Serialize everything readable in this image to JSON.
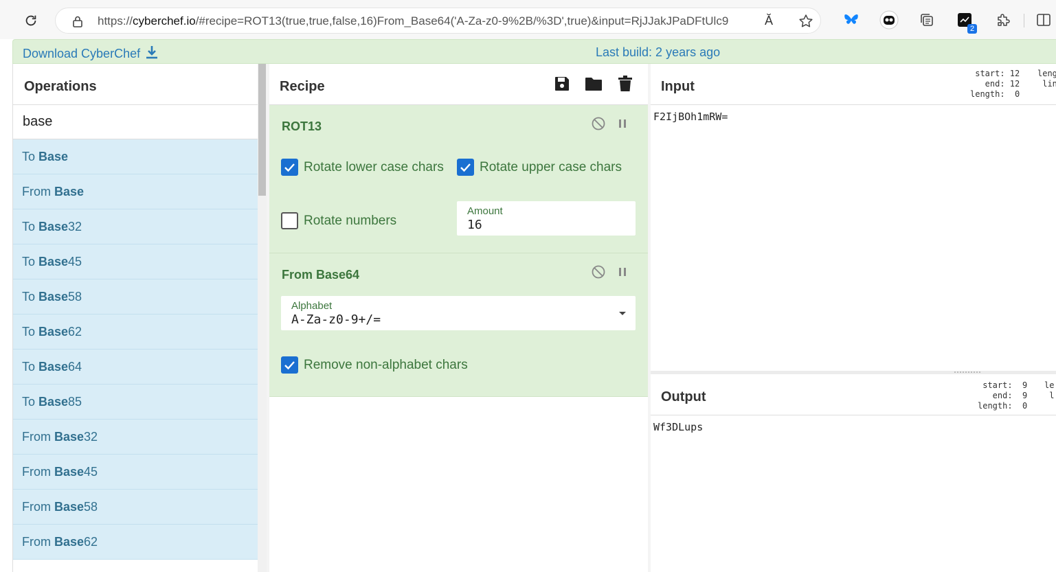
{
  "browser": {
    "url_prefix": "https://",
    "url_host": "cyberchef.io",
    "url_rest": "/#recipe=ROT13(true,true,false,16)From_Base64('A-Za-z0-9%2B/%3D',true)&input=RjJJakJPaDFtUlc9",
    "extension_badge": "2",
    "read_aloud_icon": "Ă"
  },
  "banner": {
    "download_label": "Download CyberChef",
    "last_build": "Last build: 2 years ago"
  },
  "operations": {
    "title": "Operations",
    "search_value": "base",
    "items": [
      {
        "prefix": "To ",
        "match": "Base",
        "suffix": ""
      },
      {
        "prefix": "From ",
        "match": "Base",
        "suffix": ""
      },
      {
        "prefix": "To ",
        "match": "Base",
        "suffix": "32"
      },
      {
        "prefix": "To ",
        "match": "Base",
        "suffix": "45"
      },
      {
        "prefix": "To ",
        "match": "Base",
        "suffix": "58"
      },
      {
        "prefix": "To ",
        "match": "Base",
        "suffix": "62"
      },
      {
        "prefix": "To ",
        "match": "Base",
        "suffix": "64"
      },
      {
        "prefix": "To ",
        "match": "Base",
        "suffix": "85"
      },
      {
        "prefix": "From ",
        "match": "Base",
        "suffix": "32"
      },
      {
        "prefix": "From ",
        "match": "Base",
        "suffix": "45"
      },
      {
        "prefix": "From ",
        "match": "Base",
        "suffix": "58"
      },
      {
        "prefix": "From ",
        "match": "Base",
        "suffix": "62"
      }
    ]
  },
  "recipe": {
    "title": "Recipe",
    "rot13": {
      "name": "ROT13",
      "rotate_lower": {
        "label": "Rotate lower case chars",
        "checked": true
      },
      "rotate_upper": {
        "label": "Rotate upper case chars",
        "checked": true
      },
      "rotate_numbers": {
        "label": "Rotate numbers",
        "checked": false
      },
      "amount": {
        "label": "Amount",
        "value": "16"
      }
    },
    "from_base64": {
      "name": "From Base64",
      "alphabet": {
        "label": "Alphabet",
        "value": "A-Za-z0-9+/="
      },
      "remove_non_alphabet": {
        "label": "Remove non-alphabet chars",
        "checked": true
      }
    }
  },
  "input": {
    "title": "Input",
    "stats_left": "start: 12\n  end: 12\nlength:  0",
    "stats_right": "leng\n lin",
    "value": "F2IjBOh1mRW="
  },
  "output": {
    "title": "Output",
    "stats_left": "start:  9\n  end:  9\nlength:  0",
    "stats_right": "le\n l",
    "value": "Wf3DLups"
  },
  "colors": {
    "accent_blue": "#1a6fd1",
    "op_list_bg": "#d9edf7",
    "recipe_green_bg": "#dff0d8",
    "recipe_green_text": "#3c763d",
    "link_blue": "#2a7ab8"
  }
}
